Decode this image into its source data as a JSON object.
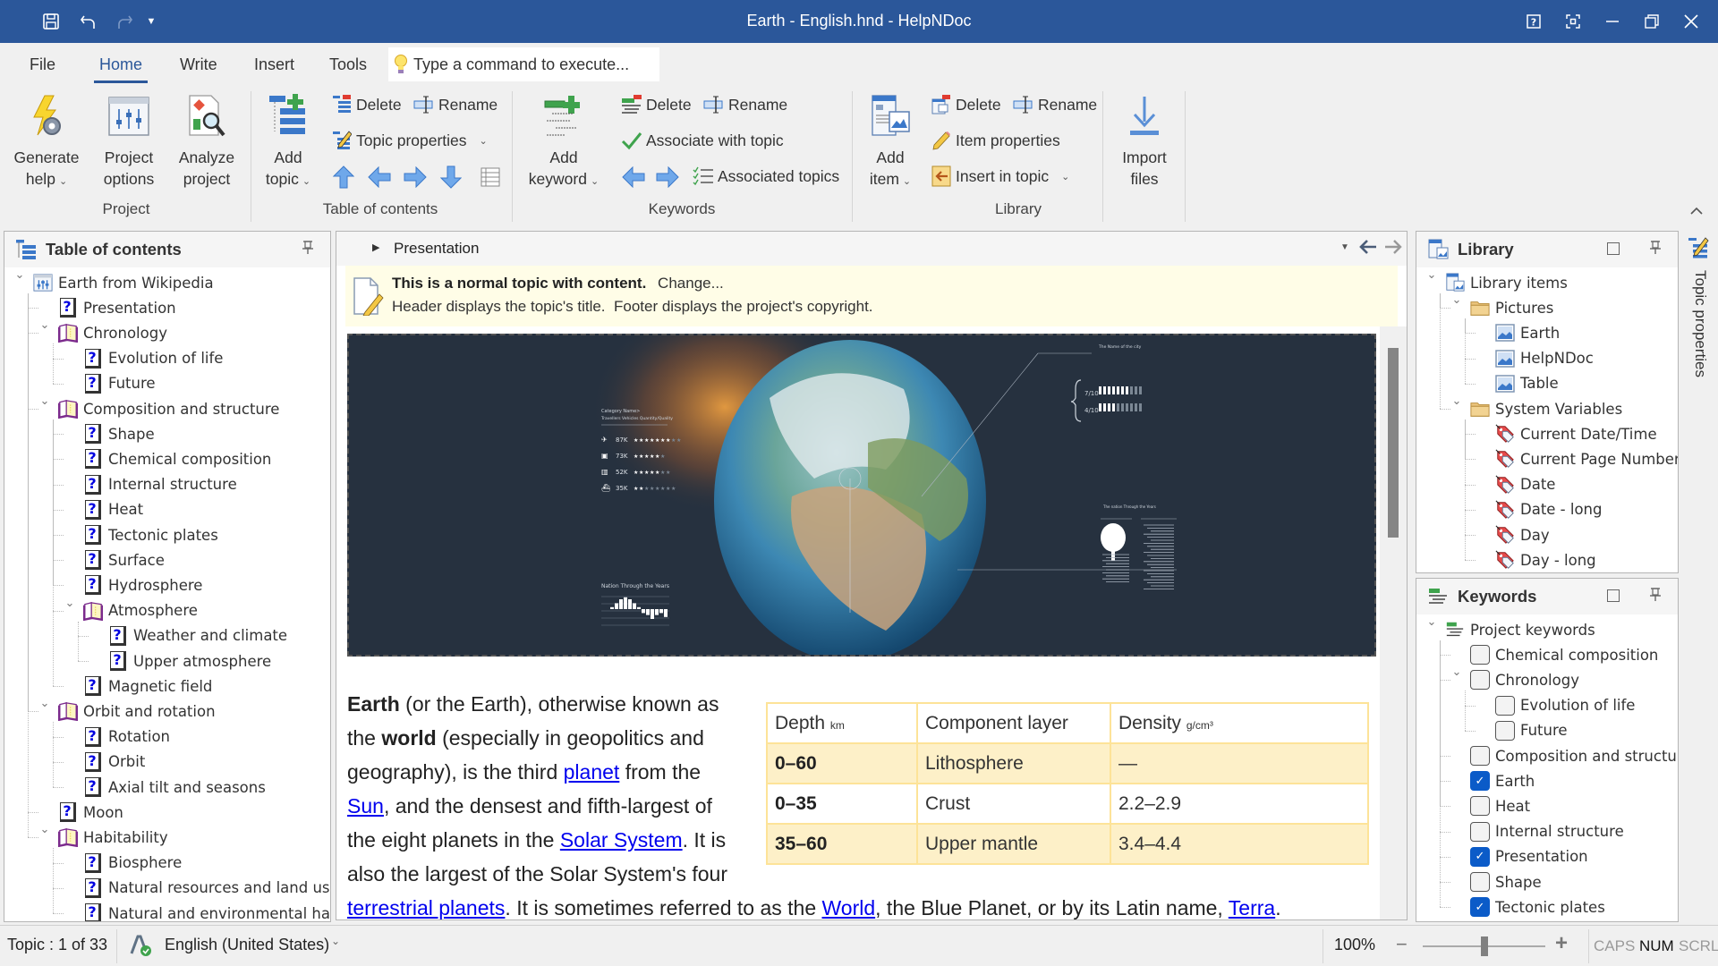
{
  "titlebar": {
    "title": "Earth - English.hnd - HelpNDoc",
    "quick_access": [
      "save-icon",
      "undo-icon",
      "redo-icon",
      "customize-dropdown-icon"
    ],
    "window_buttons": [
      "help-icon",
      "fullscreen-icon",
      "minimize-icon",
      "restore-icon",
      "close-icon"
    ]
  },
  "ribbon_tabs": [
    {
      "label": "File",
      "active": false
    },
    {
      "label": "Home",
      "active": true
    },
    {
      "label": "Write",
      "active": false
    },
    {
      "label": "Insert",
      "active": false
    },
    {
      "label": "Tools",
      "active": false
    }
  ],
  "command_box": {
    "placeholder": "Type a command to execute..."
  },
  "ribbon": {
    "project": {
      "label": "Project",
      "generate_help": [
        "Generate",
        "help"
      ],
      "project_options": [
        "Project",
        "options"
      ],
      "analyze_project": [
        "Analyze",
        "project"
      ]
    },
    "toc": {
      "label": "Table of contents",
      "add_topic": [
        "Add",
        "topic"
      ],
      "delete": "Delete",
      "rename": "Rename",
      "topic_properties": "Topic properties"
    },
    "keywords": {
      "label": "Keywords",
      "add_keyword": [
        "Add",
        "keyword"
      ],
      "delete": "Delete",
      "rename": "Rename",
      "associate": "Associate with topic",
      "associated_topics": "Associated topics"
    },
    "library": {
      "label": "Library",
      "add_item": [
        "Add",
        "item"
      ],
      "delete": "Delete",
      "rename": "Rename",
      "item_properties": "Item properties",
      "insert_in_topic": "Insert in topic"
    },
    "import": {
      "import_files": [
        "Import",
        "files"
      ]
    }
  },
  "toc_panel": {
    "title": "Table of contents",
    "items": [
      {
        "label": "Earth from Wikipedia",
        "level": 0,
        "type": "project",
        "expanded": true
      },
      {
        "label": "Presentation",
        "level": 1,
        "type": "topic"
      },
      {
        "label": "Chronology",
        "level": 1,
        "type": "book",
        "expanded": true
      },
      {
        "label": "Evolution of life",
        "level": 2,
        "type": "topic"
      },
      {
        "label": "Future",
        "level": 2,
        "type": "topic"
      },
      {
        "label": "Composition and structure",
        "level": 1,
        "type": "book",
        "expanded": true
      },
      {
        "label": "Shape",
        "level": 2,
        "type": "topic"
      },
      {
        "label": "Chemical composition",
        "level": 2,
        "type": "topic"
      },
      {
        "label": "Internal structure",
        "level": 2,
        "type": "topic"
      },
      {
        "label": "Heat",
        "level": 2,
        "type": "topic"
      },
      {
        "label": "Tectonic plates",
        "level": 2,
        "type": "topic"
      },
      {
        "label": "Surface",
        "level": 2,
        "type": "topic"
      },
      {
        "label": "Hydrosphere",
        "level": 2,
        "type": "topic"
      },
      {
        "label": "Atmosphere",
        "level": 2,
        "type": "book",
        "expanded": true
      },
      {
        "label": "Weather and climate",
        "level": 3,
        "type": "topic"
      },
      {
        "label": "Upper atmosphere",
        "level": 3,
        "type": "topic"
      },
      {
        "label": "Magnetic field",
        "level": 2,
        "type": "topic"
      },
      {
        "label": "Orbit and rotation",
        "level": 1,
        "type": "book",
        "expanded": true
      },
      {
        "label": "Rotation",
        "level": 2,
        "type": "topic"
      },
      {
        "label": "Orbit",
        "level": 2,
        "type": "topic"
      },
      {
        "label": "Axial tilt and seasons",
        "level": 2,
        "type": "topic"
      },
      {
        "label": "Moon",
        "level": 1,
        "type": "topic"
      },
      {
        "label": "Habitability",
        "level": 1,
        "type": "book",
        "expanded": true
      },
      {
        "label": "Biosphere",
        "level": 2,
        "type": "topic"
      },
      {
        "label": "Natural resources and land use",
        "level": 2,
        "type": "topic"
      },
      {
        "label": "Natural and environmental hazards",
        "level": 2,
        "type": "topic"
      }
    ]
  },
  "editor": {
    "breadcrumb": "Presentation",
    "info_title": "This is a normal topic with content.",
    "info_change": "Change...",
    "info_detail": "Header displays the topic's title.  Footer displays the project's copyright.",
    "infographic": {
      "category_label": "Category Name>",
      "category_sub": "Travellers Vehicles Quantity/Quality",
      "rows": [
        {
          "icon": "plane-icon",
          "value": "87K",
          "stars": 7,
          "of": 9
        },
        {
          "icon": "car-icon",
          "value": "73K",
          "stars": 5,
          "of": 6
        },
        {
          "icon": "train-icon",
          "value": "52K",
          "stars": 5,
          "of": 7
        },
        {
          "icon": "ship-icon",
          "value": "35K",
          "stars": 2,
          "of": 8
        }
      ],
      "city_title": "The Name of the city",
      "ratios": [
        "7/10",
        "4/10"
      ],
      "chart_title": "Nation Through the Years",
      "col_title_1": "The nation Through the Years",
      "col_title_2": "The nation Through the Years"
    },
    "article": {
      "p1_bold1": "Earth",
      "p1_t1": " (or the Earth), otherwise known as",
      "p1_t2": "the ",
      "p1_bold2": "world",
      "p1_t3": " (especially in geopolitics and",
      "p1_t4": "geography), is the third ",
      "link_planet": "planet",
      "p1_t5": " from the",
      "link_sun": "Sun",
      "p1_t6": ", and the densest and fifth-largest of",
      "p1_t7": "the eight planets in the ",
      "link_solar": "Solar System",
      "p1_t8": ". It is",
      "p1_t9": "also the largest of the Solar System's four",
      "link_terrestrial": "terrestrial planets",
      "p1_t10": ". It is sometimes referred to as the ",
      "link_world": "World",
      "p1_t11": ", the Blue Planet, or by its Latin name, ",
      "link_terra": "Terra",
      "p1_t12": "."
    },
    "table": {
      "headers": [
        {
          "label": "Depth",
          "unit": "km"
        },
        {
          "label": "Component layer",
          "unit": ""
        },
        {
          "label": "Density",
          "unit": "g/cm³"
        }
      ],
      "rows": [
        [
          "0–60",
          "Lithosphere",
          "—"
        ],
        [
          "0–35",
          "Crust",
          "2.2–2.9"
        ],
        [
          "35–60",
          "Upper mantle",
          "3.4–4.4"
        ]
      ]
    }
  },
  "library_panel": {
    "title": "Library",
    "items": [
      {
        "label": "Library items",
        "level": 0,
        "type": "library"
      },
      {
        "label": "Pictures",
        "level": 1,
        "type": "folder"
      },
      {
        "label": "Earth",
        "level": 2,
        "type": "picture"
      },
      {
        "label": "HelpNDoc",
        "level": 2,
        "type": "picture"
      },
      {
        "label": "Table",
        "level": 2,
        "type": "picture"
      },
      {
        "label": "System Variables",
        "level": 1,
        "type": "folder"
      },
      {
        "label": "Current Date/Time",
        "level": 2,
        "type": "variable"
      },
      {
        "label": "Current Page Number",
        "level": 2,
        "type": "variable"
      },
      {
        "label": "Date",
        "level": 2,
        "type": "variable"
      },
      {
        "label": "Date - long",
        "level": 2,
        "type": "variable"
      },
      {
        "label": "Day",
        "level": 2,
        "type": "variable"
      },
      {
        "label": "Day - long",
        "level": 2,
        "type": "variable"
      }
    ]
  },
  "keywords_panel": {
    "title": "Keywords",
    "items": [
      {
        "label": "Project keywords",
        "level": 0,
        "type": "root"
      },
      {
        "label": "Chemical composition",
        "level": 1,
        "checked": false
      },
      {
        "label": "Chronology",
        "level": 1,
        "checked": false,
        "expanded": true
      },
      {
        "label": "Evolution of life",
        "level": 2,
        "checked": false
      },
      {
        "label": "Future",
        "level": 2,
        "checked": false
      },
      {
        "label": "Composition and structure",
        "level": 1,
        "checked": false
      },
      {
        "label": "Earth",
        "level": 1,
        "checked": true
      },
      {
        "label": "Heat",
        "level": 1,
        "checked": false
      },
      {
        "label": "Internal structure",
        "level": 1,
        "checked": false
      },
      {
        "label": "Presentation",
        "level": 1,
        "checked": true
      },
      {
        "label": "Shape",
        "level": 1,
        "checked": false
      },
      {
        "label": "Tectonic plates",
        "level": 1,
        "checked": true
      }
    ]
  },
  "side_strip": {
    "label": "Topic properties"
  },
  "statusbar": {
    "topic_position": "Topic : 1 of 33",
    "language": "English (United States)",
    "zoom": "100%",
    "zoom_minus": "−",
    "zoom_plus": "+",
    "zoom_value_percent": 100,
    "caps": "CAPS",
    "num": "NUM",
    "scrl": "SCRL",
    "caps_on": false,
    "num_on": true,
    "scrl_on": false
  },
  "colors": {
    "accent": "#2b579a",
    "infobar": "#fffde7",
    "table_border": "#fde398",
    "table_highlight": "#fdf0c8",
    "checkbox_on": "#0b5bc8",
    "link": "#0000ee"
  }
}
